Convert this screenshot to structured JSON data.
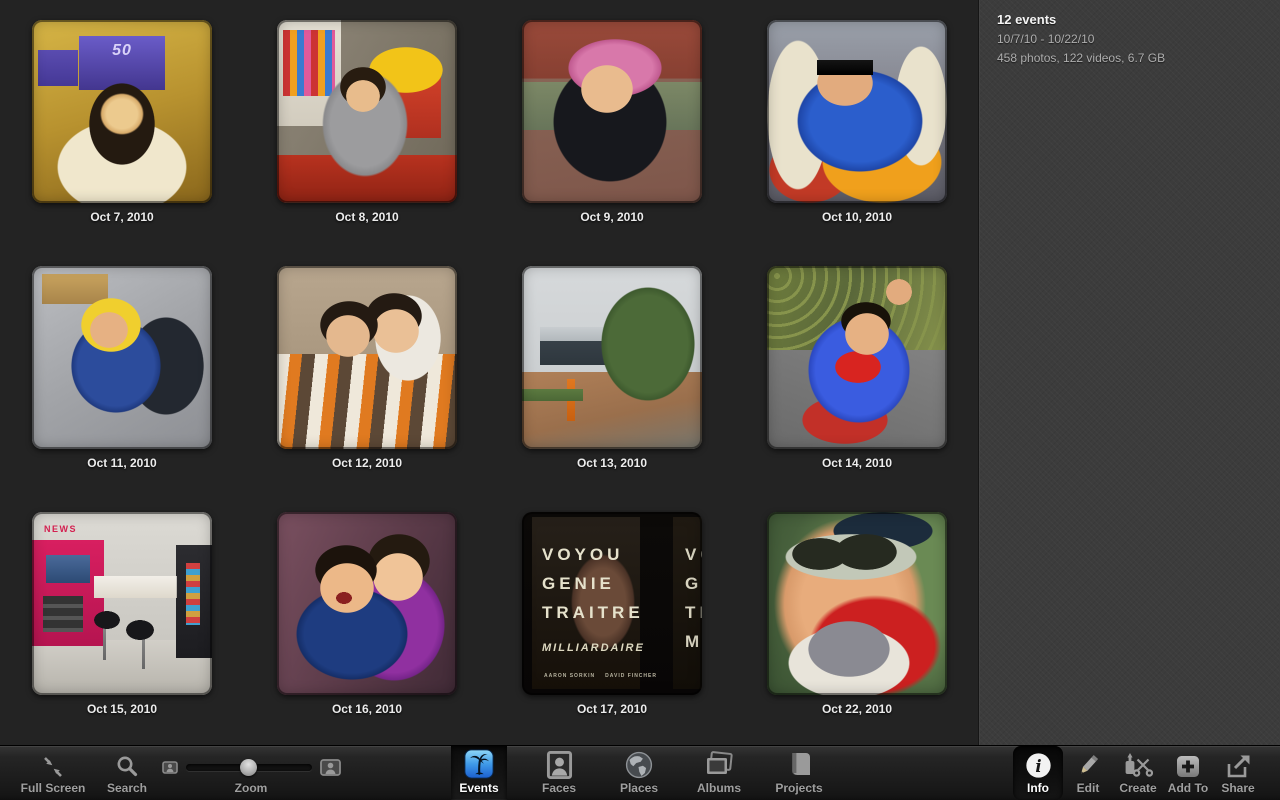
{
  "info_panel": {
    "title": "12 events",
    "date_range": "10/7/10 - 10/22/10",
    "summary": "458 photos, 122 videos, 6.7 GB"
  },
  "events": [
    {
      "date": "Oct 7, 2010",
      "desc": "Toddler seated in airplane cabin, seat-back screens showing a purple 50th-anniversary logo",
      "overlay": "50"
    },
    {
      "date": "Oct 8, 2010",
      "desc": "Toddler in gray hoodie sitting on red floor of playroom with book rack and yellow toy drums"
    },
    {
      "date": "Oct 9, 2010",
      "desc": "Child in pink striped beret and black puffer jacket in front of brick wall and green fence"
    },
    {
      "date": "Oct 10, 2010",
      "desc": "Boy wearing sunglasses and shiny blue jacket reclining in stroller on cobblestones"
    },
    {
      "date": "Oct 11, 2010",
      "desc": "Boy with yellow hood and blue sweater raising both arms on warehouse floor"
    },
    {
      "date": "Oct 12, 2010",
      "desc": "Two children hugging, wrapped in white, orange and brown striped knit"
    },
    {
      "date": "Oct 13, 2010",
      "desc": "Street view of modern glass building with trees and brick-paved road"
    },
    {
      "date": "Oct 14, 2010",
      "desc": "Boy in blue Superman costume with red cape raising his fist before a hedge"
    },
    {
      "date": "Oct 15, 2010",
      "desc": "News kiosk corner with magenta panels, two black bar stools and a vending machine",
      "overlay": "NEWS"
    },
    {
      "date": "Oct 16, 2010",
      "desc": "Laughing boy in dark blue jacket beside girl in purple puffer jacket"
    },
    {
      "date": "Oct 17, 2010",
      "desc": "French movie posters in a dark display window",
      "overlay_lines": [
        "VOYOU",
        "GENIE",
        "TRAITRE"
      ],
      "overlay_italic": "MILLIARDAIRE",
      "credit_left": "AARON SORKIN",
      "credit_right": "DAVID FINCHER"
    },
    {
      "date": "Oct 22, 2010",
      "desc": "Close-up of baby wearing silver sunglasses and red-and-white shirt, green blurred background"
    }
  ],
  "toolbar": {
    "full_screen_label": "Full Screen",
    "search_label": "Search",
    "zoom_label": "Zoom",
    "zoom_value_percent": 50,
    "views": [
      {
        "label": "Events",
        "selected": true
      },
      {
        "label": "Faces",
        "selected": false
      },
      {
        "label": "Places",
        "selected": false
      },
      {
        "label": "Albums",
        "selected": false
      },
      {
        "label": "Projects",
        "selected": false
      }
    ],
    "actions": [
      {
        "label": "Info",
        "selected": true
      },
      {
        "label": "Edit",
        "selected": false
      },
      {
        "label": "Create",
        "selected": false
      },
      {
        "label": "Add To",
        "selected": false
      },
      {
        "label": "Share",
        "selected": false
      }
    ]
  },
  "colors": {
    "events_icon_blue": "#3f9ae8",
    "selected_tab_bg": "#0c0c0c",
    "panel_bg": "#3c3c3c",
    "grid_bg": "#232323"
  }
}
